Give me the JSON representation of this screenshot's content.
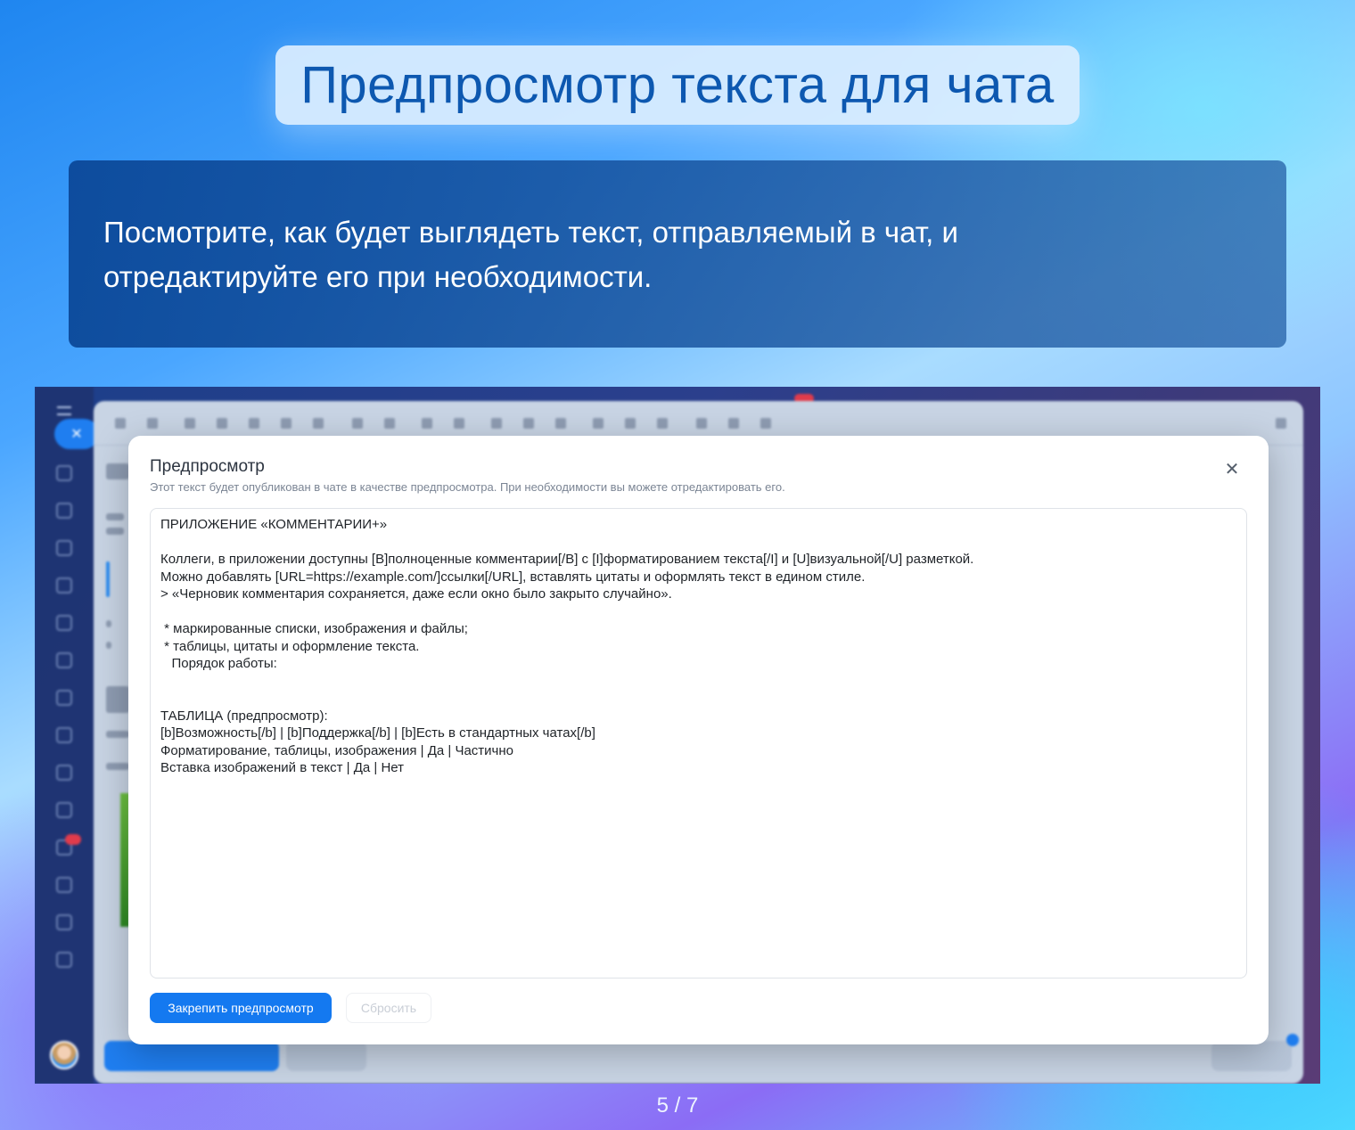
{
  "header": {
    "title": "Предпросмотр текста для чата",
    "description_line1": "Посмотрите, как будет выглядеть текст, отправляемый в чат, и",
    "description_line2": "отредактируйте его при необходимости."
  },
  "modal": {
    "title": "Предпросмотр",
    "subtitle": "Этот текст будет опубликован в чате в качестве предпросмотра. При необходимости вы можете отредактировать его.",
    "close_icon": "close-icon",
    "content_lines": [
      "ПРИЛОЖЕНИЕ «КОММЕНТАРИИ+»",
      "",
      "Коллеги, в приложении доступны [B]полноценные комментарии[/B] с [I]форматированием текста[/I] и [U]визуальной[/U] разметкой.",
      "Можно добавлять [URL=https://example.com/]ссылки[/URL], вставлять цитаты и оформлять текст в едином стиле.",
      "> «Черновик комментария сохраняется, даже если окно было закрыто случайно».",
      "",
      " * маркированные списки, изображения и файлы;",
      " * таблицы, цитаты и оформление текста.",
      "   Порядок работы:",
      "",
      "",
      "ТАБЛИЦА (предпросмотр):",
      "[b]Возможность[/b] | [b]Поддержка[/b] | [b]Есть в стандартных чатах[/b]",
      "Форматирование, таблицы, изображения | Да | Частично",
      "Вставка изображений в текст | Да | Нет"
    ],
    "pin_button": "Закрепить предпросмотр",
    "reset_button": "Сбросить"
  },
  "pager": "5 / 7",
  "colors": {
    "accent": "#1479f0",
    "title_text": "#0d58b0"
  }
}
